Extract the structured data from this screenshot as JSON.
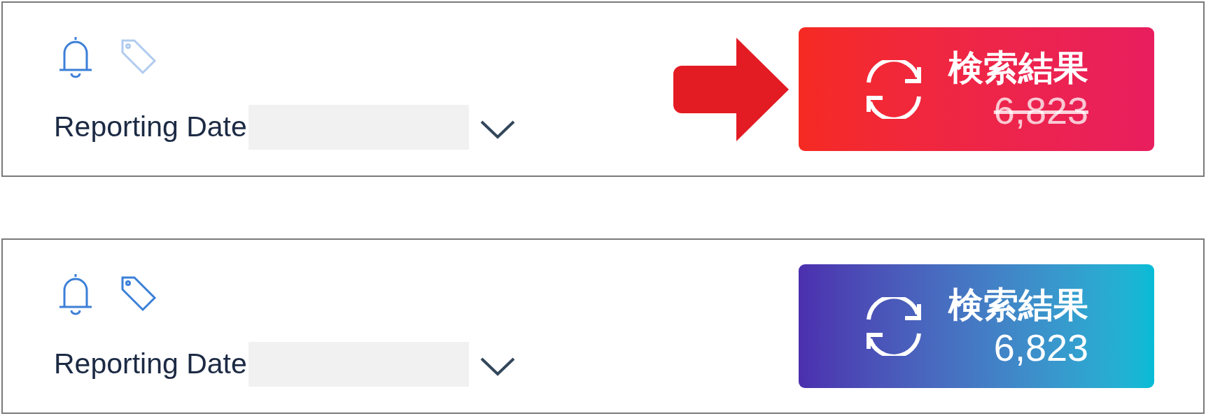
{
  "panels": [
    {
      "kind": "outdated",
      "tag_enabled": false,
      "callout_arrow": true,
      "field_label": "Reporting Date",
      "button": {
        "label": "検索結果",
        "count": "6,823"
      }
    },
    {
      "kind": "current",
      "tag_enabled": true,
      "callout_arrow": false,
      "field_label": "Reporting Date",
      "button": {
        "label": "検索結果",
        "count": "6,823"
      }
    }
  ]
}
